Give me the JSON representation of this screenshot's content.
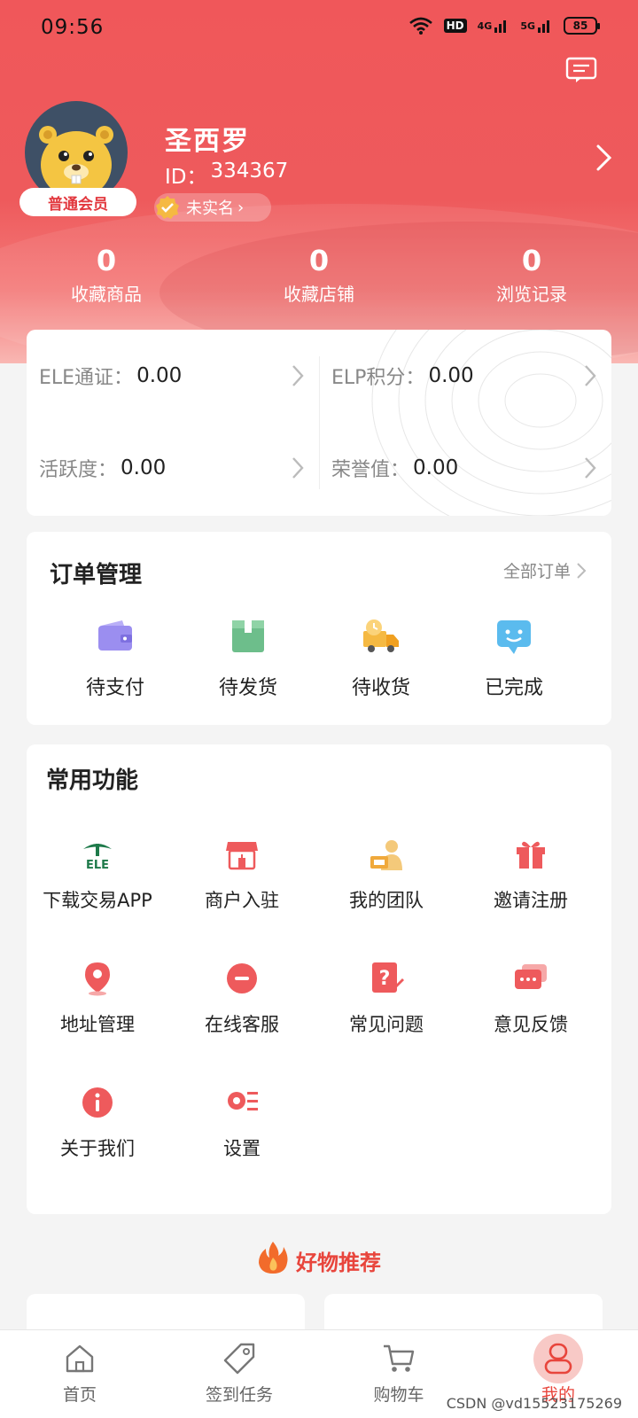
{
  "status_bar": {
    "time": "09:56",
    "hd": "HD",
    "net1": "4G",
    "net2": "5G",
    "battery": "85"
  },
  "profile": {
    "name": "圣西罗",
    "id_label": "ID：",
    "id_value": "334367",
    "member_level": "普通会员",
    "verify_status": "未实名"
  },
  "stats": [
    {
      "num": "0",
      "label": "收藏商品"
    },
    {
      "num": "0",
      "label": "收藏店铺"
    },
    {
      "num": "0",
      "label": "浏览记录"
    }
  ],
  "wallet": [
    {
      "label": "ELE通证：",
      "value": "0.00"
    },
    {
      "label": "ELP积分：",
      "value": "0.00"
    },
    {
      "label": "活跃度：",
      "value": "0.00"
    },
    {
      "label": "荣誉值：",
      "value": "0.00"
    }
  ],
  "orders": {
    "title": "订单管理",
    "all_label": "全部订单",
    "items": [
      {
        "label": "待支付",
        "icon": "wallet-icon"
      },
      {
        "label": "待发货",
        "icon": "box-icon"
      },
      {
        "label": "待收货",
        "icon": "delivery-truck-icon"
      },
      {
        "label": "已完成",
        "icon": "smile-chat-icon"
      }
    ]
  },
  "functions": {
    "title": "常用功能",
    "items": [
      {
        "label": "下载交易APP",
        "icon": "ele-logo-icon"
      },
      {
        "label": "商户入驻",
        "icon": "store-icon"
      },
      {
        "label": "我的团队",
        "icon": "team-icon"
      },
      {
        "label": "邀请注册",
        "icon": "gift-icon"
      },
      {
        "label": "地址管理",
        "icon": "location-icon"
      },
      {
        "label": "在线客服",
        "icon": "chat-dots-icon"
      },
      {
        "label": "常见问题",
        "icon": "question-icon"
      },
      {
        "label": "意见反馈",
        "icon": "feedback-icon"
      },
      {
        "label": "关于我们",
        "icon": "info-icon"
      },
      {
        "label": "设置",
        "icon": "settings-icon"
      }
    ]
  },
  "ele_logo_text": "ELE",
  "recommend_title": "好物推荐",
  "tabbar": [
    {
      "label": "首页",
      "icon": "home-icon"
    },
    {
      "label": "签到任务",
      "icon": "tag-icon"
    },
    {
      "label": "购物车",
      "icon": "cart-icon"
    },
    {
      "label": "我的",
      "icon": "user-icon"
    }
  ],
  "watermark": "CSDN @vd15523175269",
  "colors": {
    "brand_red": "#e8453c",
    "hero_red": "#f0575a"
  }
}
